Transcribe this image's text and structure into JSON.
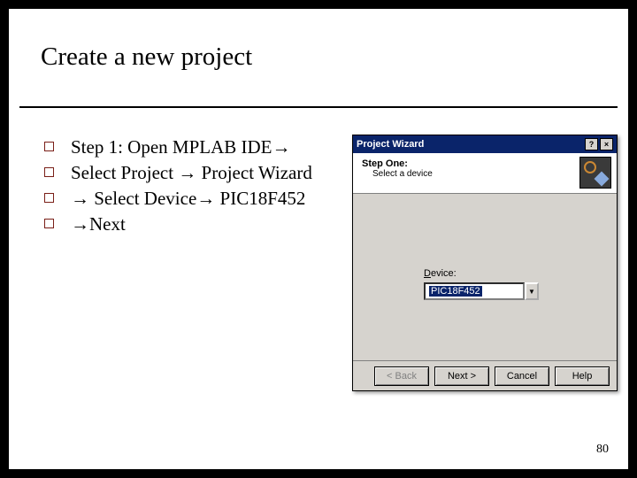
{
  "slide": {
    "title": "Create  a new project",
    "page_number": "80"
  },
  "bullets": [
    {
      "pre": "Step 1: Open MPLAB IDE"
    },
    {
      "pre": "Select Project ",
      "mid": " Project Wizard"
    },
    {
      "pre": " ",
      "mid": " Select Device",
      "post": " PIC18F452"
    },
    {
      "pre": " ",
      "mid": "Next"
    }
  ],
  "dialog": {
    "title": "Project Wizard",
    "banner_title": "Step One:",
    "banner_sub": "Select a device",
    "device_label_u": "D",
    "device_label_rest": "evice:",
    "device_value": "PIC18F452",
    "buttons": {
      "back": "< Back",
      "next": "Next >",
      "cancel": "Cancel",
      "help": "Help"
    }
  }
}
